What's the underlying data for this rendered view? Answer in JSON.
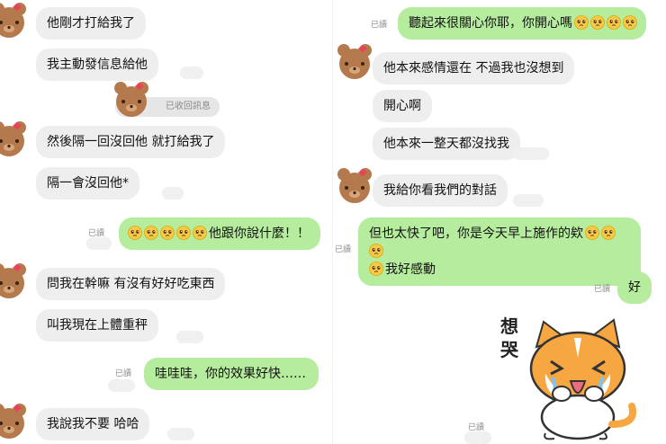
{
  "left": {
    "messages": [
      {
        "text": "他剛才打給我了"
      },
      {
        "text": "我主動發信息給他"
      },
      {
        "text": "然後隔一回沒回他 就打給我了"
      },
      {
        "text": "隔一會沒回他*"
      },
      {
        "text": "他跟你說什麼！！",
        "emoji_count": 5
      },
      {
        "text": "問我在幹嘛 有沒有好好吃東西"
      },
      {
        "text": "叫我現在上體重秤"
      },
      {
        "text": "哇哇哇，你的效果好快……"
      },
      {
        "text": "我說我不要 哈哈"
      }
    ],
    "unsent_label": "已收回訊息"
  },
  "right": {
    "messages": [
      {
        "text": "聽起來很關心你耶，你開心嗎"
      },
      {
        "text": "他本來感情還在 不過我也沒想到"
      },
      {
        "text": "開心啊"
      },
      {
        "text": "他本來一整天都沒找我"
      },
      {
        "text": "我給你看我們的對話"
      },
      {
        "text_line1": "但也太快了吧，你是今天早上施作的欸",
        "text_line2": "我好感動"
      },
      {
        "text": "好"
      }
    ],
    "sticker_text": "想哭"
  },
  "read_label": "已讀",
  "colors": {
    "incoming": "#eeeeee",
    "outgoing": "#b6ec9d",
    "bear": "#b47a4e",
    "bow": "#e8435a"
  }
}
